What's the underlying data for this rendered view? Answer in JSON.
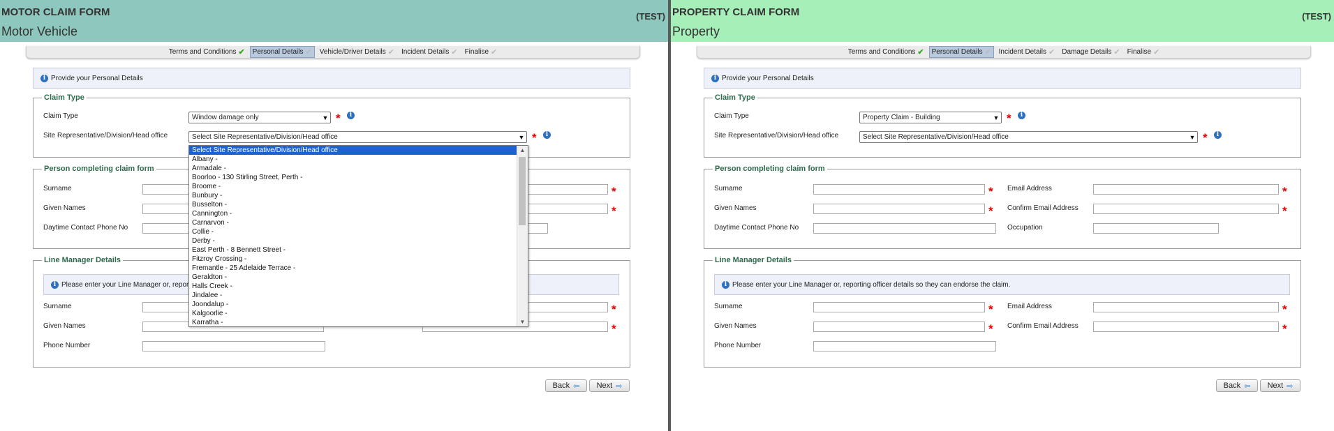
{
  "colors": {
    "motor_header": "#8ec7be",
    "property_header": "#a6efb9",
    "required": "#e00000",
    "legend": "#2e6b4d",
    "highlight": "#1e62d0"
  },
  "motor": {
    "title": "MOTOR CLAIM FORM",
    "subtitle": "Motor Vehicle",
    "test": "(TEST)",
    "steps": [
      {
        "label": "Terms and Conditions",
        "done": true
      },
      {
        "label": "Personal Details",
        "active": true
      },
      {
        "label": "Vehicle/Driver Details"
      },
      {
        "label": "Incident Details"
      },
      {
        "label": "Finalise"
      }
    ],
    "info": "Provide your Personal Details",
    "claim_type": {
      "legend": "Claim Type",
      "claim_label": "Claim Type",
      "claim_value": "Window damage only",
      "site_label": "Site Representative/Division/Head office",
      "site_value": "Select Site Representative/Division/Head office"
    },
    "person": {
      "legend": "Person completing claim form",
      "surname": "Surname",
      "given": "Given Names",
      "phone": "Daytime Contact Phone No"
    },
    "manager": {
      "legend": "Line Manager Details",
      "note": "Please enter your Line Manager or, reporti",
      "surname": "Surname",
      "given": "Given Names",
      "phone": "Phone Number"
    },
    "dropdown": [
      "Select Site Representative/Division/Head office",
      "Albany -",
      "Armadale -",
      "Boorloo - 130 Stirling Street, Perth -",
      "Broome -",
      "Bunbury -",
      "Busselton -",
      "Cannington -",
      "Carnarvon -",
      "Collie -",
      "Derby -",
      "East Perth - 8 Bennett Street -",
      "Fitzroy Crossing -",
      "Fremantle - 25 Adelaide Terrace -",
      "Geraldton -",
      "Halls Creek -",
      "Jindalee -",
      "Joondalup -",
      "Kalgoorlie -",
      "Karratha -"
    ],
    "back": "Back",
    "next": "Next"
  },
  "property": {
    "title": "PROPERTY CLAIM FORM",
    "subtitle": "Property",
    "test": "(TEST)",
    "steps": [
      {
        "label": "Terms and Conditions",
        "done": true
      },
      {
        "label": "Personal Details",
        "active": true
      },
      {
        "label": "Incident Details"
      },
      {
        "label": "Damage Details"
      },
      {
        "label": "Finalise"
      }
    ],
    "info": "Provide your Personal Details",
    "claim_type": {
      "legend": "Claim Type",
      "claim_label": "Claim Type",
      "claim_value": "Property Claim - Building",
      "site_label": "Site Representative/Division/Head office",
      "site_value": "Select Site Representative/Division/Head office"
    },
    "person": {
      "legend": "Person completing claim form",
      "surname": "Surname",
      "given": "Given Names",
      "phone": "Daytime Contact Phone No",
      "email": "Email Address",
      "confirm_email": "Confirm Email Address",
      "occupation": "Occupation"
    },
    "manager": {
      "legend": "Line Manager Details",
      "note": "Please enter your Line Manager or, reporting officer details so they can endorse the claim.",
      "surname": "Surname",
      "given": "Given Names",
      "phone": "Phone Number",
      "email": "Email Address",
      "confirm_email": "Confirm Email Address"
    },
    "back": "Back",
    "next": "Next"
  }
}
